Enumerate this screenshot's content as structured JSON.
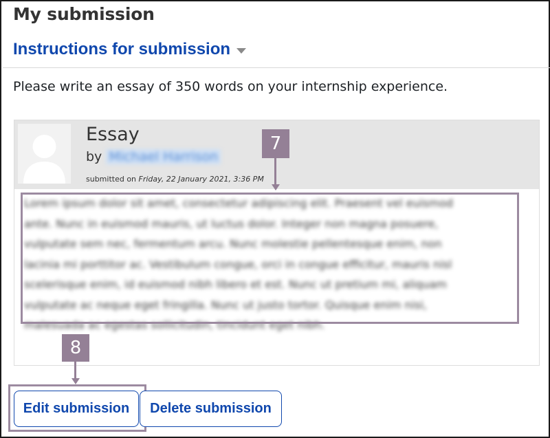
{
  "page": {
    "title": "My submission"
  },
  "instructions": {
    "toggle_label": "Instructions for submission",
    "text": "Please write an essay of 350 words on your internship experience."
  },
  "submission": {
    "title": "Essay",
    "by_label": "by",
    "author": "Michael Harrison",
    "submitted_label": "submitted on",
    "submitted_date": "Friday, 22 January 2021, 3:36 PM",
    "body_lines": [
      "Lorem ipsum dolor sit amet, consectetur adipiscing elit. Praesent vel euismod",
      "ante. Nunc in euismod mauris, ut luctus dolor. Integer non magna posuere,",
      "vulputate sem nec, fermentum arcu. Nunc molestie pellentesque enim, non",
      "lacinia mi porttitor ac. Vestibulum congue, orci in congue efficitur, mauris nisl",
      "scelerisque enim, id euismod nibh libero et est. Nunc ut pretium mi, aliquam",
      "vulputate ac neque eget fringilla. Nunc ut justo tortor. Quisque enim nisi,",
      "malesuada ac egestas sollicitudin, tincidunt eget nibh."
    ]
  },
  "annotations": {
    "callout_1": "7",
    "callout_2": "8"
  },
  "buttons": {
    "edit_label": "Edit submission",
    "delete_label": "Delete submission"
  },
  "colors": {
    "link_blue": "#0f47ad",
    "annotation_purple": "#948096",
    "header_gray": "#e5e5e5"
  },
  "icons": {
    "toggle": "caret-down-icon",
    "avatar": "user-silhouette-icon"
  }
}
